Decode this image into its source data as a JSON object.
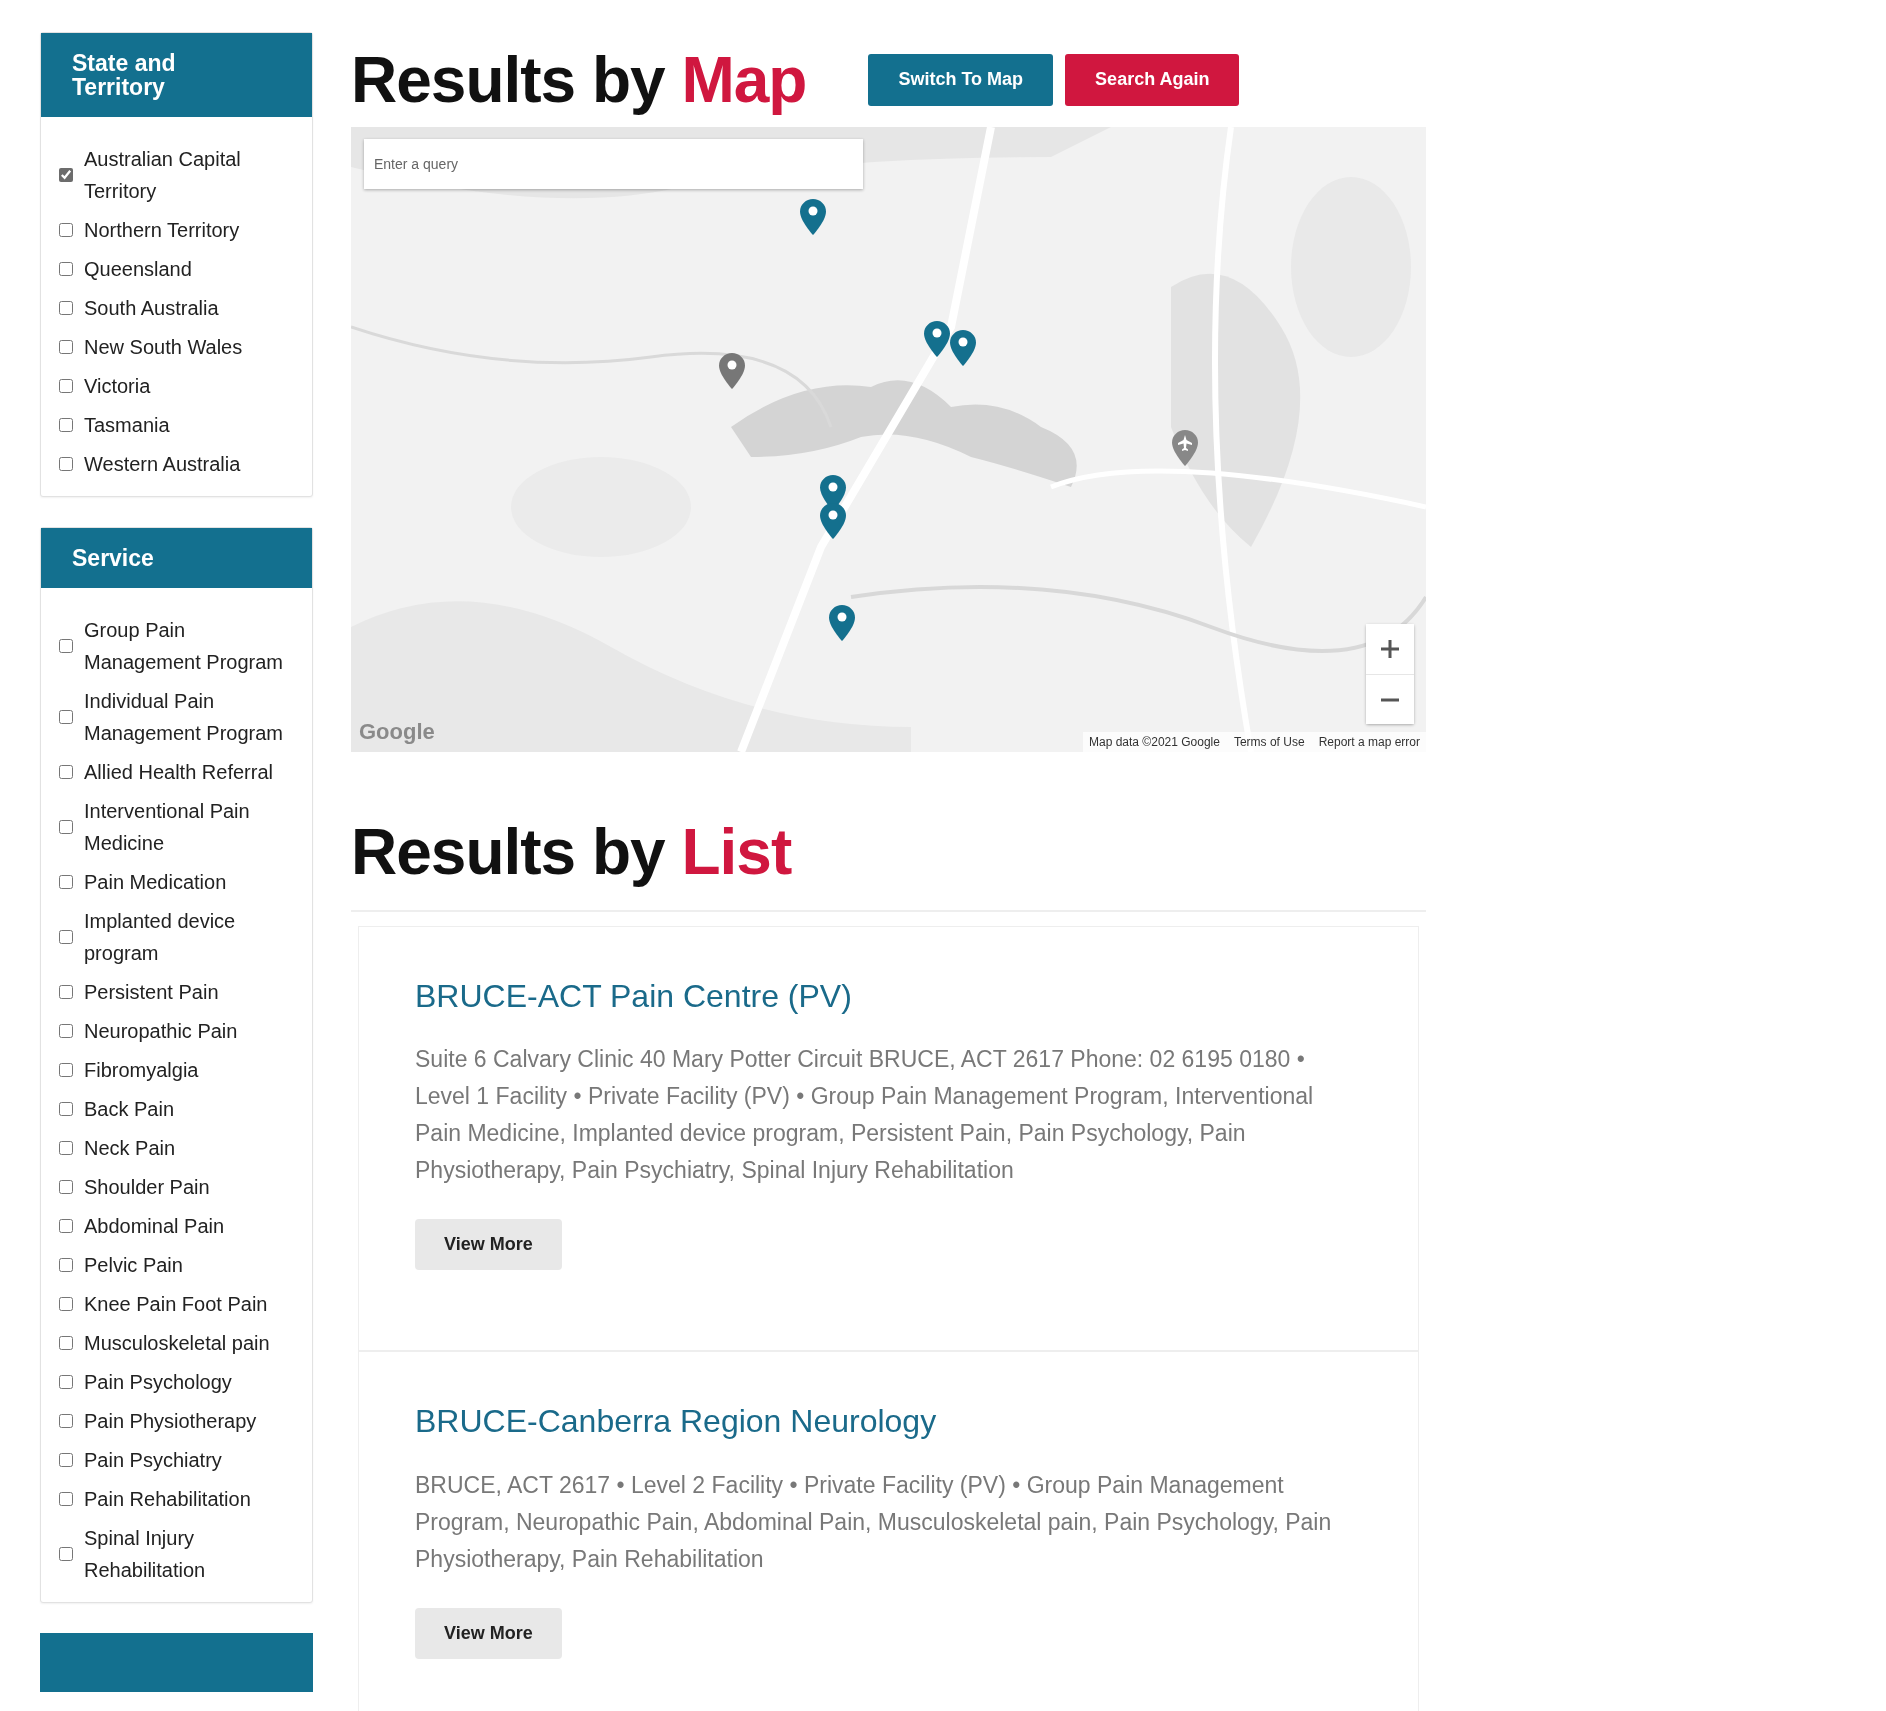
{
  "sidebar": {
    "panels": [
      {
        "title": "State and Territory",
        "options": [
          {
            "label": "Australian Capital Territory",
            "checked": true
          },
          {
            "label": "Northern Territory",
            "checked": false
          },
          {
            "label": "Queensland",
            "checked": false
          },
          {
            "label": "South Australia",
            "checked": false
          },
          {
            "label": "New South Wales",
            "checked": false
          },
          {
            "label": "Victoria",
            "checked": false
          },
          {
            "label": "Tasmania",
            "checked": false
          },
          {
            "label": "Western Australia",
            "checked": false
          }
        ]
      },
      {
        "title": "Service",
        "options": [
          {
            "label": "Group Pain Management Program",
            "checked": false
          },
          {
            "label": "Individual Pain Management Program",
            "checked": false
          },
          {
            "label": "Allied Health Referral",
            "checked": false
          },
          {
            "label": "Interventional Pain Medicine",
            "checked": false
          },
          {
            "label": "Pain Medication",
            "checked": false
          },
          {
            "label": "Implanted device program",
            "checked": false
          },
          {
            "label": "Persistent Pain",
            "checked": false
          },
          {
            "label": "Neuropathic Pain",
            "checked": false
          },
          {
            "label": "Fibromyalgia",
            "checked": false
          },
          {
            "label": "Back Pain",
            "checked": false
          },
          {
            "label": "Neck Pain",
            "checked": false
          },
          {
            "label": "Shoulder Pain",
            "checked": false
          },
          {
            "label": "Abdominal Pain",
            "checked": false
          },
          {
            "label": "Pelvic Pain",
            "checked": false
          },
          {
            "label": "Knee Pain Foot Pain",
            "checked": false
          },
          {
            "label": "Musculoskeletal pain",
            "checked": false
          },
          {
            "label": "Pain Psychology",
            "checked": false
          },
          {
            "label": "Pain Physiotherapy",
            "checked": false
          },
          {
            "label": "Pain Psychiatry",
            "checked": false
          },
          {
            "label": "Pain Rehabilitation",
            "checked": false
          },
          {
            "label": "Spinal Injury Rehabilitation",
            "checked": false
          }
        ]
      }
    ]
  },
  "map_section": {
    "heading": {
      "text": "Results by",
      "accent": "Map"
    },
    "buttons": [
      {
        "label": "Switch To Map",
        "kind": "primary"
      },
      {
        "label": "Search Again",
        "kind": "danger"
      }
    ],
    "map": {
      "kind": "picture",
      "search_placeholder": "Enter a query",
      "logo": "Google",
      "attribution": [
        "Map data ©2021 Google",
        "Terms of Use",
        "Report a map error"
      ]
    }
  },
  "list_section": {
    "heading": {
      "text": "Results by",
      "accent": "List"
    },
    "results": [
      {
        "title": "BRUCE-ACT Pain Centre (PV)",
        "details": "Suite 6 Calvary Clinic 40 Mary Potter Circuit BRUCE, ACT 2617 Phone: 02 6195 0180 •  Level 1 Facility •  Private Facility (PV) • Group Pain Management Program, Interventional Pain Medicine, Implanted device program, Persistent Pain, Pain Psychology, Pain Physiotherapy, Pain Psychiatry, Spinal Injury Rehabilitation",
        "button": "View More"
      },
      {
        "title": "BRUCE-Canberra Region Neurology",
        "details": "BRUCE, ACT 2617  •  Level 2 Facility •  Private Facility (PV) • Group Pain Management Program, Neuropathic Pain, Abdominal Pain, Musculoskeletal pain, Pain Psychology, Pain Physiotherapy, Pain Rehabilitation",
        "button": "View More"
      }
    ]
  }
}
